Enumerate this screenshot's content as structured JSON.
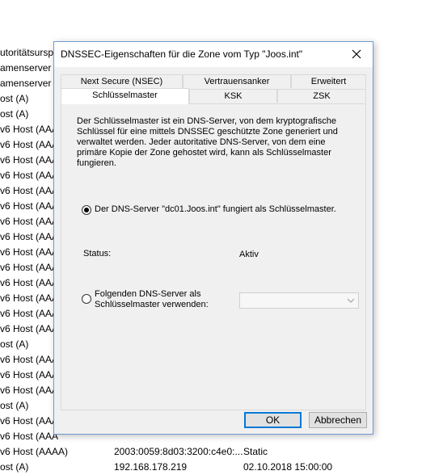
{
  "background_list": {
    "rows": [
      {
        "c1": "utoritätsursp",
        "c2": "",
        "c3": ""
      },
      {
        "c1": "amenserver (",
        "c2": "",
        "c3": ""
      },
      {
        "c1": "amenserver (",
        "c2": "",
        "c3": ""
      },
      {
        "c1": "ost (A)",
        "c2": "",
        "c3": ""
      },
      {
        "c1": "ost (A)",
        "c2": "",
        "c3": ""
      },
      {
        "c1": "v6 Host (AAA",
        "c2": "",
        "c3": ""
      },
      {
        "c1": "v6 Host (AAA",
        "c2": "",
        "c3": ""
      },
      {
        "c1": "v6 Host (AAA",
        "c2": "",
        "c3": ""
      },
      {
        "c1": "v6 Host (AAA",
        "c2": "",
        "c3": ""
      },
      {
        "c1": "v6 Host (AAA",
        "c2": "",
        "c3": ""
      },
      {
        "c1": "v6 Host (AAA",
        "c2": "",
        "c3": ""
      },
      {
        "c1": "v6 Host (AAA",
        "c2": "",
        "c3": ""
      },
      {
        "c1": "v6 Host (AAA",
        "c2": "",
        "c3": ""
      },
      {
        "c1": "v6 Host (AAA",
        "c2": "",
        "c3": ""
      },
      {
        "c1": "v6 Host (AAA",
        "c2": "",
        "c3": ""
      },
      {
        "c1": "v6 Host (AAA",
        "c2": "",
        "c3": ""
      },
      {
        "c1": "v6 Host (AAA",
        "c2": "",
        "c3": ""
      },
      {
        "c1": "v6 Host (AAA",
        "c2": "",
        "c3": ""
      },
      {
        "c1": "v6 Host (AAA",
        "c2": "",
        "c3": ""
      },
      {
        "c1": "ost (A)",
        "c2": "",
        "c3": ""
      },
      {
        "c1": "v6 Host (AAA",
        "c2": "",
        "c3": ""
      },
      {
        "c1": "v6 Host (AAA",
        "c2": "",
        "c3": ""
      },
      {
        "c1": "v6 Host (AAA",
        "c2": "",
        "c3": ""
      },
      {
        "c1": "ost (A)",
        "c2": "",
        "c3": ""
      },
      {
        "c1": "v6 Host (AAA",
        "c2": "",
        "c3": ""
      },
      {
        "c1": "v6 Host (AAA",
        "c2": "",
        "c3": ""
      },
      {
        "c1": "v6 Host (AAAA)",
        "c2": "2003:0059:8d03:3200:c4e0:...",
        "c3": "Static"
      },
      {
        "c1": "ost (A)",
        "c2": "192.168.178.219",
        "c3": "02.10.2018 15:00:00"
      }
    ]
  },
  "dialog": {
    "title": "DNSSEC-Eigenschaften für die Zone vom Typ \"Joos.int\"",
    "tabs_row1": [
      "Next Secure (NSEC)",
      "Vertrauensanker",
      "Erweitert"
    ],
    "tabs_row2": [
      "Schlüsselmaster",
      "KSK",
      "ZSK"
    ],
    "active_tab": "Schlüsselmaster",
    "description": "Der Schlüsselmaster ist ein DNS-Server, von dem kryptografische Schlüssel für eine mittels DNSSEC geschützte Zone generiert und verwaltet werden. Jeder autoritative DNS-Server, von dem eine primäre Kopie der Zone gehostet wird, kann als Schlüsselmaster fungieren.",
    "option1_label": "Der DNS-Server \"dc01.Joos.int\" fungiert als Schlüsselmaster.",
    "status_label": "Status:",
    "status_value": "Aktiv",
    "option2_label_line1": "Folgenden DNS-Server als",
    "option2_label_line2": "Schlüsselmaster verwenden:",
    "combo_value": "",
    "ok_label": "OK",
    "cancel_label": "Abbrechen"
  }
}
